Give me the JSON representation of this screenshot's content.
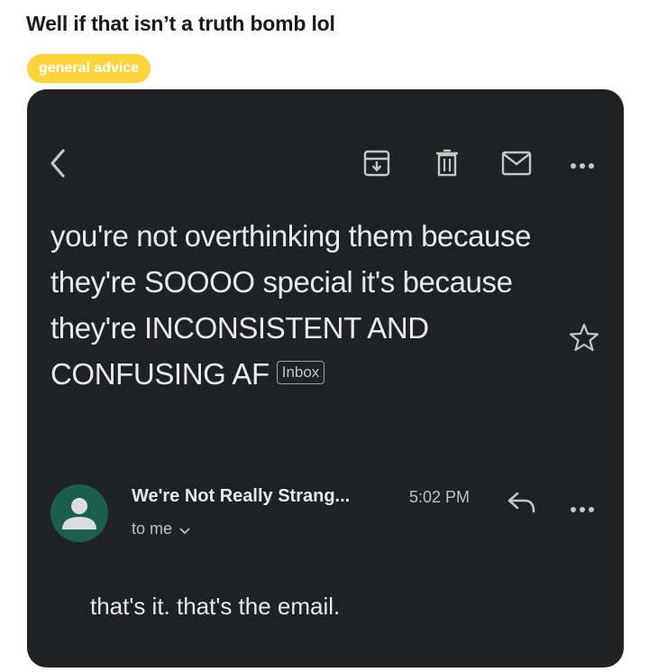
{
  "post": {
    "title": "Well if that isn’t a truth bomb lol",
    "flair": "general advice",
    "flair_color": "#ffd43b"
  },
  "email": {
    "background": "#202124",
    "toolbar": {
      "back": "back-arrow-icon",
      "archive": "archive-icon",
      "delete": "trash-icon",
      "mark_unread": "mail-icon",
      "more": "more-vert-icon"
    },
    "subject": "you're not overthinking them because they're SOOOO special it's because they're INCONSISTENT AND CONFUSING AF",
    "label_chip": "Inbox",
    "sender": {
      "name": "We're Not Really Strang...",
      "time": "5:02 PM",
      "recipient": "to me",
      "avatar_color": "#1b5e4a"
    },
    "body": "that's it. that's the email."
  }
}
